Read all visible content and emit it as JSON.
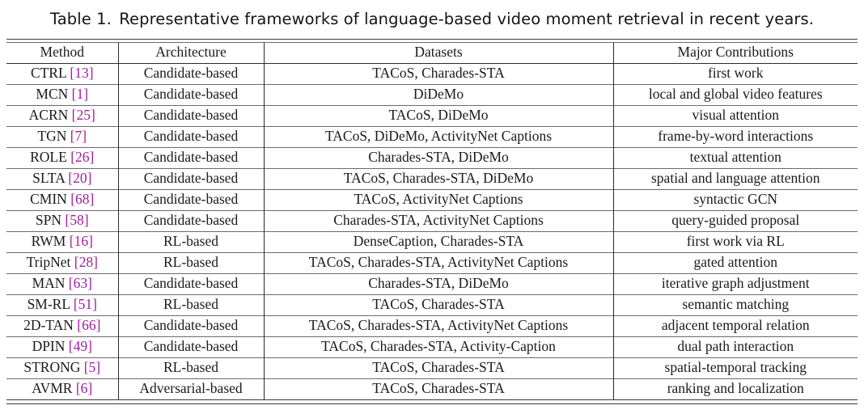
{
  "caption": {
    "number": "Table 1.",
    "text": "Representative frameworks of language-based video moment retrieval in recent years."
  },
  "colors": {
    "citation": "#a020a0",
    "text": "#1a1a1a",
    "rule": "#6b6b6b"
  },
  "table": {
    "columns": [
      "Method",
      "Architecture",
      "Datasets",
      "Major Contributions"
    ],
    "rows": [
      {
        "method": "CTRL",
        "cite": "[13]",
        "architecture": "Candidate-based",
        "datasets": "TACoS, Charades-STA",
        "contribution": "first work"
      },
      {
        "method": "MCN",
        "cite": "[1]",
        "architecture": "Candidate-based",
        "datasets": "DiDeMo",
        "contribution": "local and global video features"
      },
      {
        "method": "ACRN",
        "cite": "[25]",
        "architecture": "Candidate-based",
        "datasets": "TACoS, DiDeMo",
        "contribution": "visual attention"
      },
      {
        "method": "TGN",
        "cite": "[7]",
        "architecture": "Candidate-based",
        "datasets": "TACoS, DiDeMo, ActivityNet Captions",
        "contribution": "frame-by-word interactions"
      },
      {
        "method": "ROLE",
        "cite": "[26]",
        "architecture": "Candidate-based",
        "datasets": "Charades-STA, DiDeMo",
        "contribution": "textual attention"
      },
      {
        "method": "SLTA",
        "cite": "[20]",
        "architecture": "Candidate-based",
        "datasets": "TACoS, Charades-STA, DiDeMo",
        "contribution": "spatial and language attention"
      },
      {
        "method": "CMIN",
        "cite": "[68]",
        "architecture": "Candidate-based",
        "datasets": "TACoS, ActivityNet Captions",
        "contribution": "syntactic GCN"
      },
      {
        "method": "SPN",
        "cite": "[58]",
        "architecture": "Candidate-based",
        "datasets": "Charades-STA, ActivityNet Captions",
        "contribution": "query-guided proposal"
      },
      {
        "method": "RWM",
        "cite": "[16]",
        "architecture": "RL-based",
        "datasets": "DenseCaption, Charades-STA",
        "contribution": "first work via RL"
      },
      {
        "method": "TripNet",
        "cite": "[28]",
        "architecture": "RL-based",
        "datasets": "TACoS, Charades-STA, ActivityNet Captions",
        "contribution": "gated attention"
      },
      {
        "method": "MAN",
        "cite": "[63]",
        "architecture": "Candidate-based",
        "datasets": "Charades-STA, DiDeMo",
        "contribution": "iterative graph adjustment"
      },
      {
        "method": "SM-RL",
        "cite": "[51]",
        "architecture": "RL-based",
        "datasets": "TACoS, Charades-STA",
        "contribution": "semantic matching"
      },
      {
        "method": "2D-TAN",
        "cite": "[66]",
        "architecture": "Candidate-based",
        "datasets": "TACoS, Charades-STA, ActivityNet Captions",
        "contribution": "adjacent temporal relation"
      },
      {
        "method": "DPIN",
        "cite": "[49]",
        "architecture": "Candidate-based",
        "datasets": "TACoS, Charades-STA, Activity-Caption",
        "contribution": "dual path interaction"
      },
      {
        "method": "STRONG",
        "cite": "[5]",
        "architecture": "RL-based",
        "datasets": "TACoS, Charades-STA",
        "contribution": "spatial-temporal tracking"
      },
      {
        "method": "AVMR",
        "cite": "[6]",
        "architecture": "Adversarial-based",
        "datasets": "TACoS, Charades-STA",
        "contribution": "ranking and localization"
      }
    ]
  }
}
